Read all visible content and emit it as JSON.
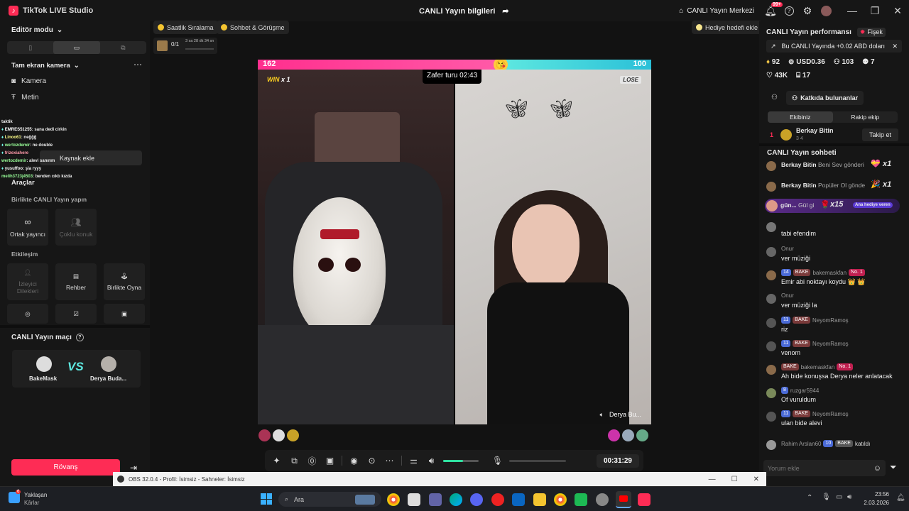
{
  "window": {
    "app_name": "TikTok LIVE Studio",
    "center_title": "CANLI Yayın bilgileri",
    "live_center": "CANLI Yayın Merkezi",
    "notif_count": "99+"
  },
  "left": {
    "editor_mode": "Editör modu",
    "fullscreen_cam": "Tam ekran kamera",
    "camera": "Kamera",
    "text": "Metin",
    "add_source": "Kaynak ekle",
    "tools": "Araçlar",
    "collab_live": "Birlikte CANLI Yayın yapın",
    "co_host": "Ortak yayıncı",
    "multi_guest": "Çoklu konuk",
    "interaction": "Etkileşim",
    "viewer_requests": "İzleyici Dilekleri",
    "guide": "Rehber",
    "play_together": "Birlikte Oyna",
    "match_title": "CANLI Yayın maçı",
    "player1": "BakeMask",
    "player2": "Derya Buda...",
    "rematch": "Rövanş",
    "chat_overlay": [
      {
        "name": "taktik",
        "msg": ""
      },
      {
        "name": "EMRES51255",
        "msg": ": sana dedi cirkin"
      },
      {
        "name": "Linoo61",
        "msg": ": neğğğ"
      },
      {
        "name": "wertozdemir",
        "msg": ": ne double"
      },
      {
        "name": "frizexiahere",
        "msg": ""
      },
      {
        "name": "wertozdemir",
        "msg": ": alevi sanırım"
      },
      {
        "name": "yusuffoo",
        "msg": ": şia ryyy"
      },
      {
        "name": "melih3723j4503",
        "msg": ": benden cıktı kızda"
      }
    ]
  },
  "stage": {
    "hourly_rank": "Saatlik Sıralama",
    "chat_meet": "Sohbet & Görüşme",
    "goal_progress": "0/1",
    "goal_time": "3 sa 28 dk 34 sn",
    "gift_goal": "Hediye hedefi ekle",
    "score_left": "162",
    "score_right": "100",
    "score_left_share": 0.618,
    "win_label": "WIN",
    "win_count": "x 1",
    "lose_label": "LOSE",
    "victory": "Zafer turu 02:43",
    "guest_name": "Derya Bu...",
    "timer": "00:31:29",
    "volume_level": 0.55
  },
  "right": {
    "perf_title": "CANLI Yayın performansı",
    "firework": "Fişek",
    "earn_note": "Bu CANLI Yayında +0.02 ABD doları",
    "stats": {
      "diamonds": "92",
      "usd": "USD0.36",
      "viewers": "103",
      "gifters": "7",
      "likes": "43K",
      "gifts": "17"
    },
    "contributors": "Katkıda bulunanlar",
    "tab_team": "Ekibiniz",
    "tab_rival": "Rakip ekip",
    "rank": "1",
    "top_user": "Berkay Bitin",
    "top_user_sub": "3   4",
    "follow": "Takip et",
    "chat_title": "CANLI Yayın sohbeti",
    "gifts_list": [
      {
        "user": "Berkay Bitin",
        "text": "Beni Sev gönderi",
        "count": "x1"
      },
      {
        "user": "Berkay Bitin",
        "text": "Popüler Ol gönde",
        "count": "x1"
      },
      {
        "user": "gün...",
        "text": "Gül gi",
        "count": "x15",
        "tag": "Ana hediye veren"
      }
    ],
    "messages": [
      {
        "user": "Onur",
        "text": "tabi efendim"
      },
      {
        "user": "Onur",
        "text": "ver müziği"
      },
      {
        "user": "bakemaskfan",
        "level": "14",
        "badge": "BAKE",
        "no": "No. 1",
        "text": "Emir abi noktayı koydu 👑 👑"
      },
      {
        "user": "Onur",
        "text": "ver müziği la"
      },
      {
        "user": "NeyomRamoş",
        "level": "11",
        "badge": "BAKE",
        "text": "riz"
      },
      {
        "user": "NeyomRamoş",
        "level": "11",
        "badge": "BAKE",
        "text": "venom"
      },
      {
        "user": "bakemaskfan",
        "badge": "BAKE",
        "no": "No. 1",
        "text": "Ah bide konuşsa Derya neler anlatacak"
      },
      {
        "user": "ruzgar5944",
        "level": "8",
        "text": "Of vuruldum"
      },
      {
        "user": "NeyomRamoş",
        "level": "11",
        "badge": "BAKE",
        "text": "ulan bide alevi"
      }
    ],
    "join_user": "Rahim Arslan60",
    "join_level": "10",
    "join_badge": "BAKE",
    "join_text": "katıldı",
    "comment_placeholder": "Yorum ekle"
  },
  "obs": {
    "title": "OBS 32.0.4 - Profil: İsimsiz - Sahneler: İsimsiz"
  },
  "taskbar": {
    "weather_title": "Yaklaşan",
    "weather_sub": "Kârlar",
    "weather_badge": "6",
    "search": "Ara",
    "time": "23:56",
    "date": "2.03.2026"
  }
}
